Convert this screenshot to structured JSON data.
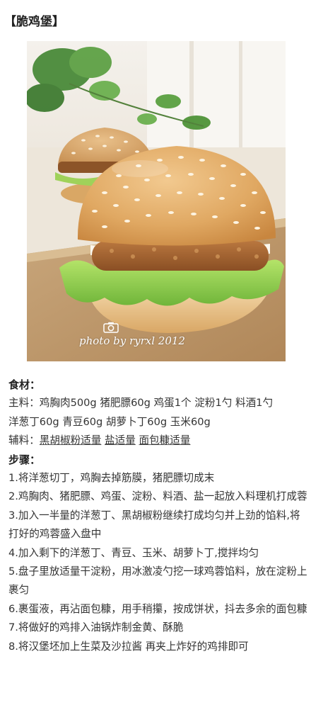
{
  "title": "【脆鸡堡】",
  "photo": {
    "credit": "photo by ryrxl 2012"
  },
  "ingredients": {
    "heading": "食材：",
    "main_line": "主料：鸡胸肉500g 猪肥膘60g 鸡蛋1个 淀粉1勺 料酒1勺",
    "main_line2": "洋葱丁60g 青豆60g 胡萝卜丁60g 玉米60g",
    "aux_prefix": "辅料：",
    "aux_items": [
      "黑胡椒粉适量",
      "盐适量",
      "面包糠适量"
    ]
  },
  "steps": {
    "heading": "步骤：",
    "items": [
      "1.将洋葱切丁，鸡胸去掉筋膜，猪肥膘切成末",
      "2.鸡胸肉、猪肥膘、鸡蛋、淀粉、料酒、盐一起放入料理机打成蓉",
      "3.加入一半量的洋葱丁、黑胡椒粉继续打成均匀并上劲的馅料,将打好的鸡蓉盛入盘中",
      "4.加入剩下的洋葱丁、青豆、玉米、胡萝卜丁,搅拌均匀",
      "5.盘子里放适量干淀粉，用冰激凌勺挖一球鸡蓉馅料，放在淀粉上裹匀",
      "6.裹蛋液，再沾面包糠，用手稍攥，按成饼状，抖去多余的面包糠",
      "7.将做好的鸡排入油锅炸制金黄、酥脆",
      "8.将汉堡坯加上生菜及沙拉酱 再夹上炸好的鸡排即可"
    ]
  }
}
